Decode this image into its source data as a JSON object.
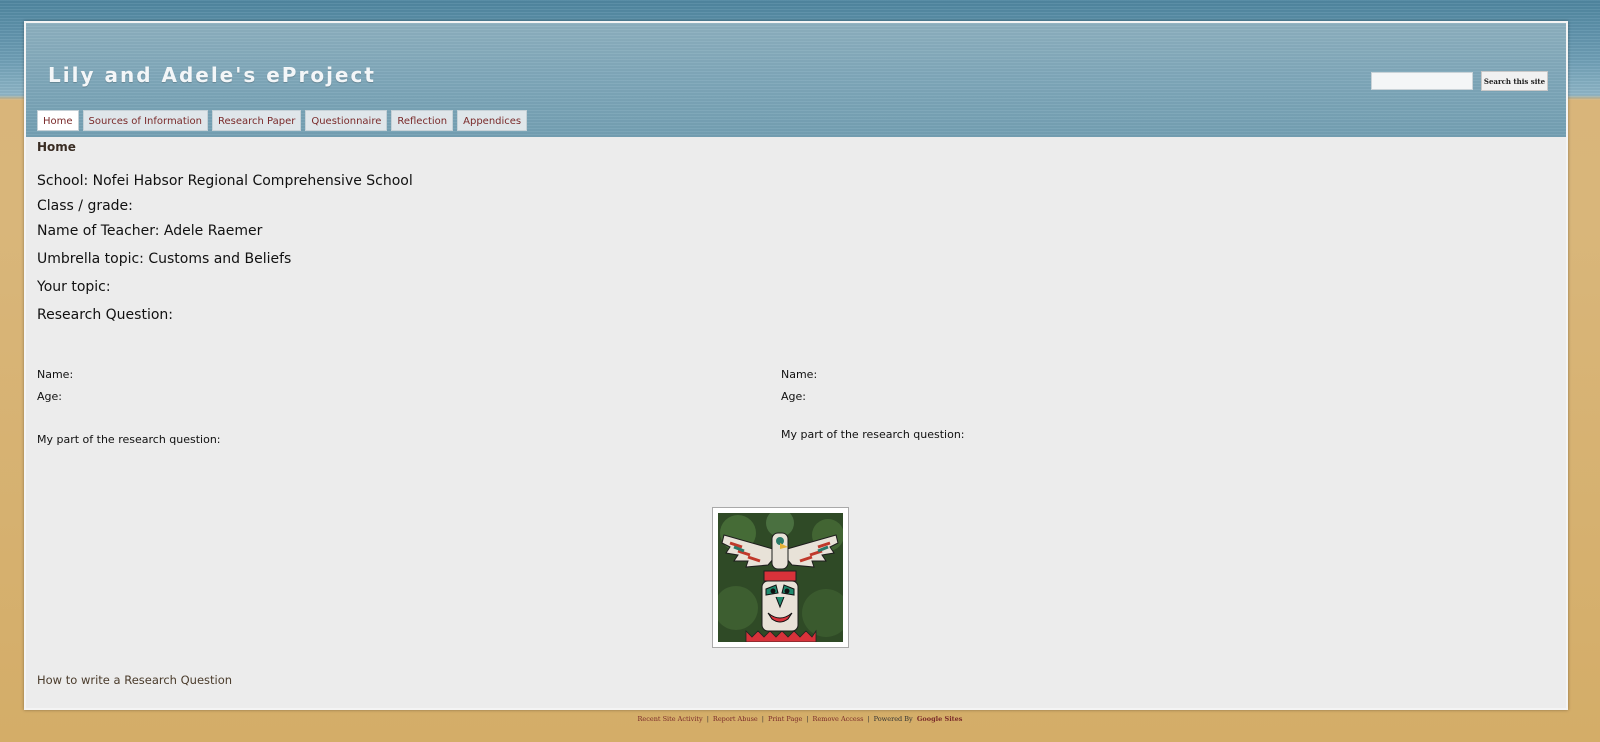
{
  "site": {
    "title": "Lily and Adele's eProject"
  },
  "search": {
    "placeholder": "",
    "button_label": "Search this site"
  },
  "nav": {
    "tabs": [
      {
        "label": "Home",
        "active": true
      },
      {
        "label": "Sources of Information",
        "active": false
      },
      {
        "label": "Research Paper",
        "active": false
      },
      {
        "label": "Questionnaire",
        "active": false
      },
      {
        "label": "Reflection",
        "active": false
      },
      {
        "label": "Appendices",
        "active": false
      }
    ]
  },
  "breadcrumb": "Home",
  "info": {
    "school": "School: Nofei Habsor Regional Comprehensive School",
    "class_grade": "Class / grade:",
    "teacher": "Name of Teacher: Adele Raemer",
    "umbrella": "Umbrella topic: Customs and Beliefs",
    "your_topic": "Your topic:",
    "research_question": "Research Question:"
  },
  "students": [
    {
      "name_label": "Name:",
      "age_label": "Age:",
      "part_label": "My part of the research question:"
    },
    {
      "name_label": "Name:",
      "age_label": "Age:",
      "part_label": "My part of the research question:"
    }
  ],
  "image": {
    "subject": "totem-pole-photo"
  },
  "links": {
    "howto": "How to write a Research Question"
  },
  "footer": {
    "recent": "Recent Site Activity",
    "report": "Report Abuse",
    "print": "Print Page",
    "remove": "Remove Access",
    "powered": "Powered By",
    "google": "Google Sites",
    "separator": "|"
  },
  "colors": {
    "header": "#7ea7b9",
    "content_bg": "#ececec",
    "link": "#7a2a2a",
    "page_bg": "#d9b67a"
  }
}
